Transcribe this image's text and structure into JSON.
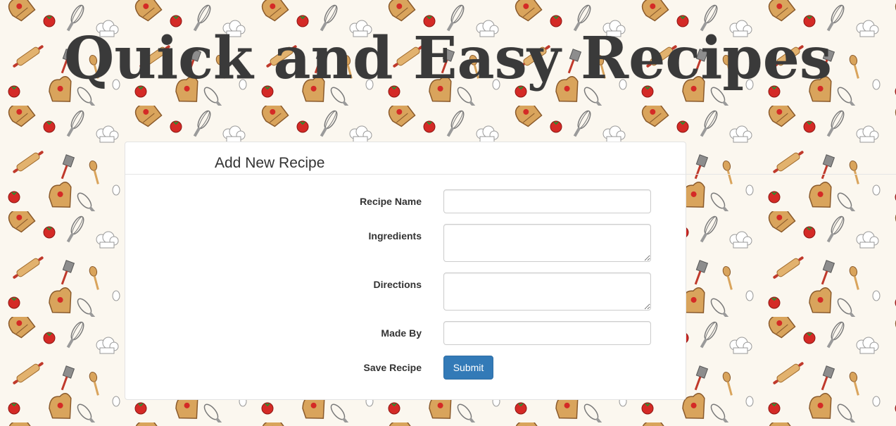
{
  "page": {
    "title": "Quick and Easy Recipes",
    "background_pattern": "kitchen-utensils-pattern"
  },
  "form": {
    "heading": "Add New Recipe",
    "fields": [
      {
        "label": "Recipe Name",
        "value": "",
        "placeholder": ""
      },
      {
        "label": "Ingredients",
        "value": "",
        "placeholder": ""
      },
      {
        "label": "Directions",
        "value": "",
        "placeholder": ""
      },
      {
        "label": "Made By",
        "value": "",
        "placeholder": ""
      }
    ],
    "save_label": "Save Recipe",
    "submit_label": "Submit"
  },
  "colors": {
    "primary_button": "#337ab7",
    "title_text": "#3a3a3a",
    "pattern_red": "#d42a26",
    "pattern_tan": "#d9a45c"
  }
}
